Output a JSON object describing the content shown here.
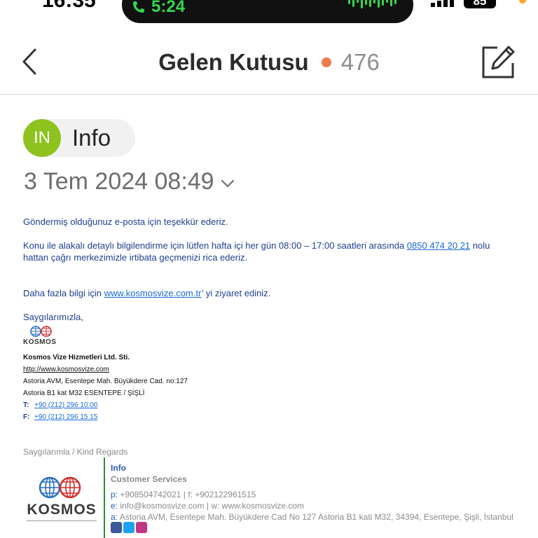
{
  "status_bar": {
    "time": "16:35",
    "call_timer": "5:24",
    "battery": "85"
  },
  "nav": {
    "title": "Gelen Kutusu",
    "unread_count": "476"
  },
  "email": {
    "sender_initials": "IN",
    "sender_name": "Info",
    "date": "3 Tem 2024 08:49",
    "body": {
      "p1": "Göndermiş olduğunuz e-posta için teşekkür ederiz.",
      "p2_a": "Konu ile alakalı detaylı bilgilendirme için lütfen hafta içi her gün 08:00 – 17:00 saatleri arasında ",
      "p2_phone": "0850 474 20 21",
      "p2_b": " nolu",
      "p2_c": "hattan çağrı merkezimizle irtibata geçmenizi rica ederiz.",
      "p3_a": "Daha fazla bilgi için ",
      "p3_link": "www.kosmosvize.com.tr",
      "p3_b": "’ yi ziyaret ediniz.",
      "closing": "Saygılarımızla,"
    },
    "signature": {
      "logo_text": "KOSMOS",
      "company": "Kosmos Vize Hizmetleri Ltd. Sti.",
      "url": "http://www.kosmosvize.com",
      "address1": "Astoria AVM, Esentepe Mah. Büyükdere Cad. no:127",
      "address2": "Astoria B1 kat M32 ESENTEPE / ŞİŞLİ",
      "t_label": "T:",
      "t_value": "+90 (212) 296 10 00",
      "f_label": "F:",
      "f_value": "+90 (212) 296 15 15"
    },
    "card": {
      "regards": "Saygılarımla / Kind Regards",
      "logo_text": "KOSMOS",
      "name": "Info",
      "role": "Customer Services",
      "p_label": "p:",
      "p_value": " +908504742021 | f: +902122961515",
      "e_label": "e:",
      "e_value": " info@kosmosvize.com | w: www.kosmosvize.com",
      "a_label": "a:",
      "a_value": " Astoria AVM, Esentepe Mah. Büyükdere Cad No 127  Astoria B1 kati M32, 34394, Esentepe, Şişli, İstanbul"
    }
  },
  "colors": {
    "avatar": "#8ec21f",
    "unread_dot": "#f07a4a",
    "link": "#1a6ad6",
    "call_green": "#32d74b"
  },
  "icons": [
    "phone-icon",
    "signal-icon",
    "back-chevron-icon",
    "compose-icon",
    "chevron-down-icon",
    "globe-logo-icon",
    "facebook-icon",
    "twitter-icon",
    "instagram-icon"
  ]
}
